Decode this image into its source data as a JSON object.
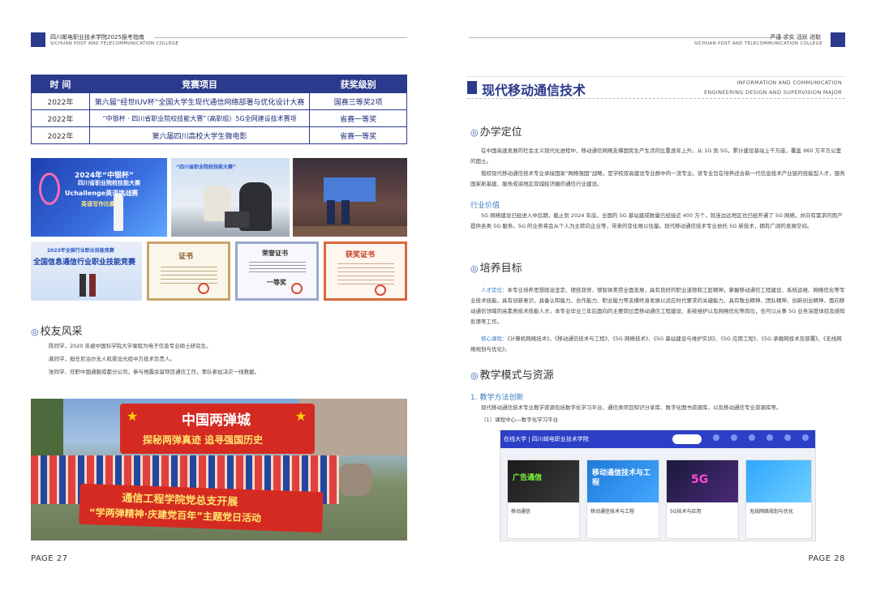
{
  "left": {
    "header": {
      "cn": "四川邮电职业技术学院2025报考指南",
      "en": "SICHUAN POST AND TELECOMMUNICATION  COLLEGE"
    },
    "table": {
      "headers": [
        "时 间",
        "竞赛项目",
        "获奖级别"
      ],
      "rows": [
        [
          "2022年",
          "第六届“经世IUV杯”全国大学生现代通信网络部署与优化设计大赛",
          "国赛三等奖2项"
        ],
        [
          "2022年",
          "“中银杯 · 四川省职业院校技能大赛”（高职组）5G全网建设技术赛项",
          "省赛一等奖"
        ],
        [
          "2022年",
          "第六届四川高校大学生微电影",
          "省赛一等奖"
        ]
      ]
    },
    "photos": {
      "p1_title": "2024年“中银杯”",
      "p1_sub": "四川省职业院校技能大赛",
      "p1_brand": "Uchallenge英语挑战赛",
      "p1_sub2": "英语写作比赛",
      "p2_text": "“四川省职业院校技能大赛”",
      "p4_title": "2023年全国行业职业技能竞赛",
      "p4_main": "全国信息通信行业职业技能竞赛",
      "p5_title": "证书",
      "p6_title": "荣誉证书",
      "p6_award": "一等奖",
      "p7_title": "获奖证书"
    },
    "alumni": {
      "title": "校友风采",
      "lines": [
        "陈同学，2020 年被中国科学院大学录取为电子信息专业硕士研究生。",
        "龚同学，担任尼泊尔无人机渠设光缆中方技术负责人。",
        "张同学，任职中国通服成都分公司，参与地震余留项目通信工作，率队参加决灾一线救援。"
      ]
    },
    "group_photo": {
      "banner_top": "中国两弹城",
      "banner_mid": "探秘两弹真迹  追寻强国历史",
      "banner_bottom1": "通信工程学院党总支开展",
      "banner_bottom2": "“学两弹精神·庆建党百年”主题党日活动"
    },
    "page_no": "PAGE 27"
  },
  "right": {
    "header": {
      "cn": "严谨  求实  活跃  进取",
      "en": "SICHUAN POST AND TELECOMMUNICATION  COLLEGE"
    },
    "title": "现代移动通信技术",
    "title_en1": "INFORMATION AND COMMUNICATION",
    "title_en2": "ENGINEERING DESIGN AND SUPERVISION MAJOR",
    "s1": {
      "title": "办学定位",
      "p1": "在中国高速发展的社会主义现代化进程中，移动通信网络支撑国民生产生活的比重逐年上升。从 1G 到 5G，累计建设基站上千万座，覆盖 960 万平方公里的国土。",
      "p2": "我校现代移动通信技术专业承接国家“网络强国”战略，是学校双高建设专业群中的一流专业。该专业旨在培养适合新一代信息技术产业链的技能型人才，服务国家新基建、服务成渝地区双城经济圈的通信行业建设。",
      "sub": "行业价值",
      "p3": "5G 网络建设已经进入中后期，截止到 2024 年底，全国的 5G 基站建成数量已经接近 400 万个，就连边远地区也已经开通了 5G 网络，并向有需求的用户提供各类 5G 服务。5G 的业务将会从个人为主转向企业等，带来的变化难以估量。现代移动通信技术专业依托 5G 新技术，拥有广阔的发展空间。"
    },
    "s2": {
      "title": "培养目标",
      "t1": "人才定位：",
      "p1": "本专业培养思想政治坚定、德技双修、德智体美劳全面发展，具有良好的职业道德和工匠精神，掌握移动通信工程建设、系统运维、网络优化等专业技术技能，具有创新意识，具备认知能力、合作能力、职业能力等支撑终身发展以适应时代要求的关键能力，具有敬业精神、团队精神、创新创业精神，面向移动通信领域的高素质技术技能人才。本专业毕业三年后面向的主要岗位是移动通信工程建设、系统维护以及网络优化等岗位，也可以从事 5G 业务深度体验及感知反馈等工作。",
      "t2": "核心课程：",
      "p2": "《计算机网络技术》、《移动通信技术与工程》、《5G 网络技术》、《5G 基站建设与维护实训》、《5G 应用工程》、《5G 承载网技术及部署》、《无线网络规划与优化》。"
    },
    "s3": {
      "title": "教学模式与资源",
      "sub": "1. 教学方法创新",
      "p1": "现代移动通信技术专业教学资源包括数字化学习平台、通信类项目知识分享库、数字化图书资源库，以及移动通信专业资源库等。",
      "p2": "（1）课程中心—数字化学习平台"
    },
    "platform": {
      "brand": "在线大学 | 四川邮电职业技术学院",
      "courses": [
        {
          "banner": "广告通信",
          "name": "移动通信"
        },
        {
          "banner": "移动通信技术与工程",
          "name": "移动通信技术与工程"
        },
        {
          "banner": "5G",
          "name": "5G技术与应用"
        },
        {
          "banner": "",
          "name": "无线网络规划与优化"
        }
      ]
    },
    "page_no": "PAGE 28"
  }
}
